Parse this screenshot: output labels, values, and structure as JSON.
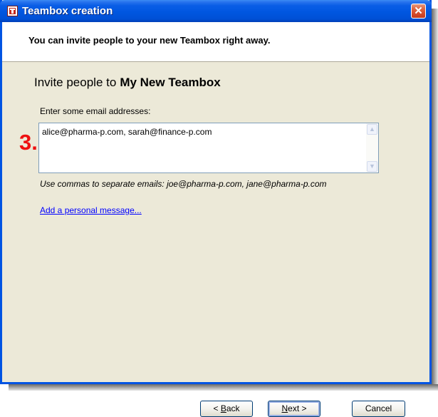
{
  "window": {
    "title": "Teambox creation",
    "close_glyph": "✕"
  },
  "header": {
    "text": "You can invite people to your new Teambox right away."
  },
  "main": {
    "invite_prefix": "Invite people to",
    "teambox_name": "My New Teambox",
    "email_label": "Enter some email addresses:",
    "email_value": "alice@pharma-p.com, sarah@finance-p.com",
    "hint": "Use commas to separate emails: joe@pharma-p.com,  jane@pharma-p.com",
    "add_message_link": "Add a personal message..."
  },
  "annotation": {
    "number": "3",
    "dot": "."
  },
  "buttons": {
    "back_underlined": "B",
    "back_rest": "ack",
    "back_prefix": "< ",
    "next_underlined": "N",
    "next_rest": "ext >",
    "cancel": "Cancel"
  },
  "icons": {
    "app": "teambox-icon",
    "close": "close-icon",
    "scroll_up": "scroll-up-arrow-icon",
    "scroll_down": "scroll-down-arrow-icon"
  },
  "colors": {
    "titlebar": "#0054e3",
    "close_button": "#d4492a",
    "link": "#0000ff",
    "marker": "#ee1111"
  }
}
